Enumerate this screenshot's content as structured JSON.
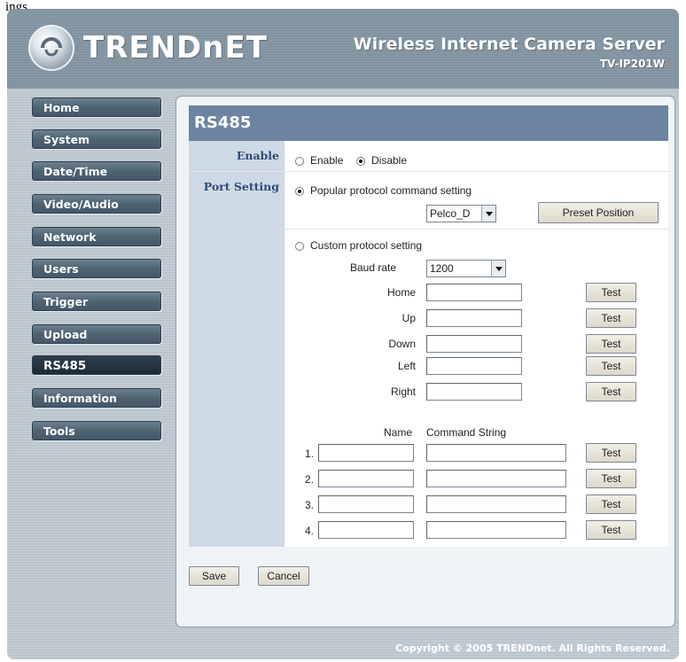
{
  "page_fragment": "ings",
  "brand": {
    "logo_text": "TRENDnET",
    "product_title": "Wireless Internet Camera Server",
    "product_model": "TV-IP201W"
  },
  "nav": {
    "items": [
      {
        "label": "Home"
      },
      {
        "label": "System"
      },
      {
        "label": "Date/Time"
      },
      {
        "label": "Video/Audio"
      },
      {
        "label": "Network"
      },
      {
        "label": "Users"
      },
      {
        "label": "Trigger"
      },
      {
        "label": "Upload"
      },
      {
        "label": "RS485"
      },
      {
        "label": "Information"
      },
      {
        "label": "Tools"
      }
    ],
    "active": "RS485"
  },
  "panel": {
    "title": "RS485",
    "enable_row": {
      "label": "Enable",
      "options": [
        "Enable",
        "Disable"
      ],
      "selected": "Disable"
    },
    "port_row": {
      "label": "Port Setting",
      "popular": {
        "label": "Popular protocol command setting",
        "selected": true,
        "protocol_value": "Pelco_D",
        "preset_button": "Preset Position"
      },
      "custom": {
        "label": "Custom protocol setting",
        "selected": false,
        "baud_label": "Baud rate",
        "baud_value": "1200",
        "directions": [
          {
            "label": "Home",
            "value": "",
            "test": "Test"
          },
          {
            "label": "Up",
            "value": "",
            "test": "Test"
          },
          {
            "label": "Down",
            "value": "",
            "test": "Test"
          },
          {
            "label": "Left",
            "value": "",
            "test": "Test"
          },
          {
            "label": "Right",
            "value": "",
            "test": "Test"
          }
        ],
        "name_header": "Name",
        "command_header": "Command String",
        "commands": [
          {
            "index": "1.",
            "name": "",
            "command": "",
            "test": "Test"
          },
          {
            "index": "2.",
            "name": "",
            "command": "",
            "test": "Test"
          },
          {
            "index": "3.",
            "name": "",
            "command": "",
            "test": "Test"
          },
          {
            "index": "4.",
            "name": "",
            "command": "",
            "test": "Test"
          }
        ]
      }
    },
    "save_label": "Save",
    "cancel_label": "Cancel"
  },
  "footer": {
    "copyright": "Copyright © 2005 TRENDnet. All Rights Reserved."
  }
}
